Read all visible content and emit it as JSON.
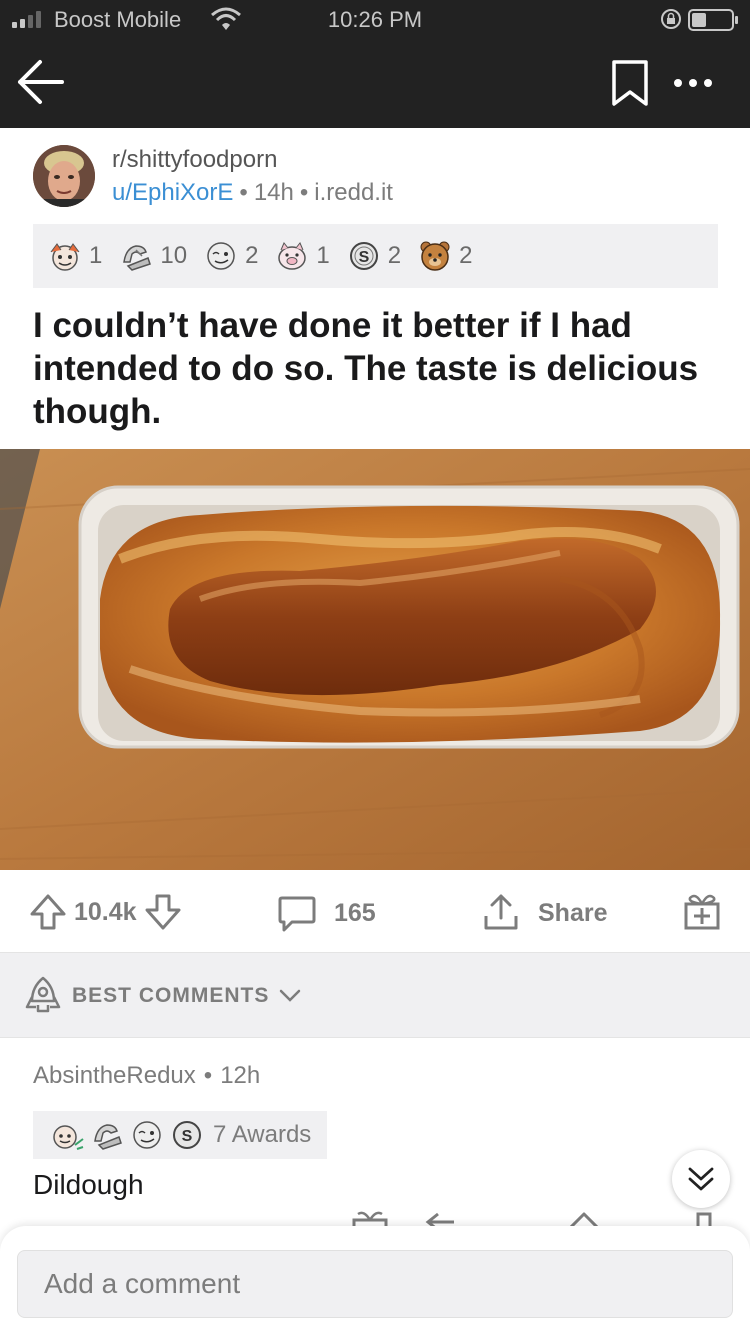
{
  "status_bar": {
    "carrier": "Boost Mobile",
    "time": "10:26 PM"
  },
  "post": {
    "subreddit": "r/shittyfoodporn",
    "username": "u/EphiXorE",
    "age": "14h",
    "domain": "i.redd.it",
    "title": "I couldn’t have done it better if I had intended to do so. The taste is delicious though.",
    "awards": [
      {
        "icon": "wholesome-award-icon",
        "count": "1"
      },
      {
        "icon": "silver-arm-award-icon",
        "count": "10"
      },
      {
        "icon": "face-award-icon",
        "count": "2"
      },
      {
        "icon": "pig-award-icon",
        "count": "1"
      },
      {
        "icon": "coin-award-icon",
        "count": "2"
      },
      {
        "icon": "bear-award-icon",
        "count": "2"
      }
    ],
    "upvotes": "10.4k",
    "comments": "165",
    "share_label": "Share"
  },
  "sort": {
    "label": "BEST COMMENTS"
  },
  "comment": {
    "author": "AbsintheRedux",
    "age": "12h",
    "awards_label": "7 Awards",
    "body": "Dildough"
  },
  "composer": {
    "placeholder": "Add a comment"
  },
  "colors": {
    "header_bg": "#222222",
    "link_blue": "#3b8fd4",
    "muted_gray": "#7c7c7c",
    "panel_gray": "#f0f0f2"
  }
}
